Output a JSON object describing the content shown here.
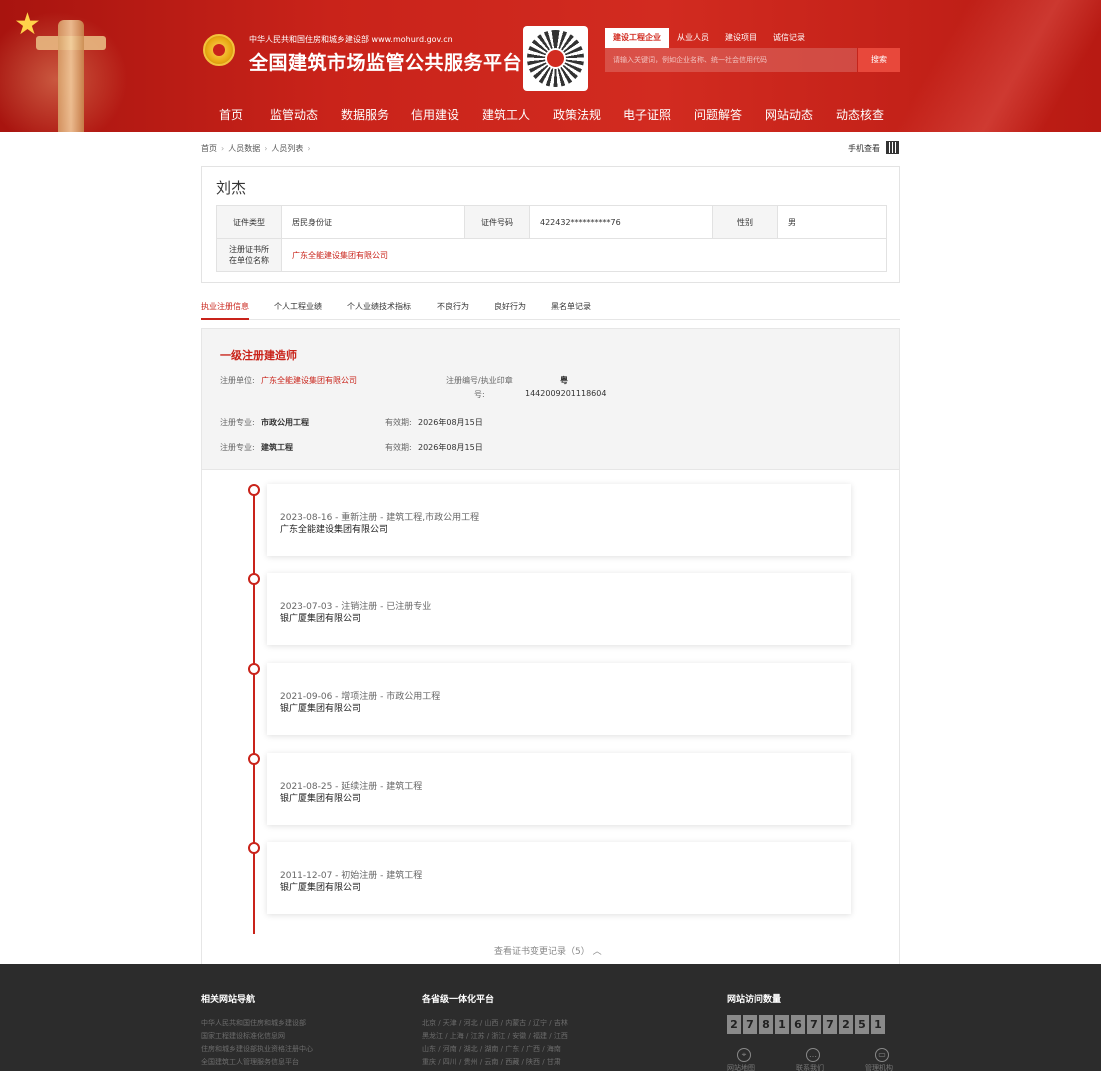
{
  "header": {
    "org_line": "中华人民共和国住房和城乡建设部  www.mohurd.gov.cn",
    "site_title": "全国建筑市场监管公共服务平台",
    "search_tabs": [
      "建设工程企业",
      "从业人员",
      "建设项目",
      "诚信记录"
    ],
    "search_placeholder": "请输入关键词，例如企业名称、统一社会信用代码",
    "search_button": "搜索"
  },
  "nav": [
    "首页",
    "监管动态",
    "数据服务",
    "信用建设",
    "建筑工人",
    "政策法规",
    "电子证照",
    "问题解答",
    "网站动态",
    "动态核查"
  ],
  "breadcrumb": [
    "首页",
    "人员数据",
    "人员列表"
  ],
  "mobile_view": "手机查看",
  "person": {
    "name": "刘杰",
    "id_type_label": "证件类型",
    "id_type": "居民身份证",
    "id_no_label": "证件号码",
    "id_no": "422432**********76",
    "gender_label": "性别",
    "gender": "男",
    "company_label": "注册证书所在单位名称",
    "company": "广东全能建设集团有限公司"
  },
  "tabs": [
    "执业注册信息",
    "个人工程业绩",
    "个人业绩技术指标",
    "不良行为",
    "良好行为",
    "黑名单记录"
  ],
  "registration": {
    "title": "一级注册建造师",
    "unit_label": "注册单位:",
    "unit": "广东全能建设集团有限公司",
    "reg_no_label_1": "注册编号/执业印章",
    "reg_no_label_2": "号:",
    "reg_no_prefix": "粤",
    "reg_no": "144200920111860​4",
    "specialties": [
      {
        "label": "注册专业:",
        "name": "市政公用工程",
        "valid_label": "有效期:",
        "valid": "2026年08月15日"
      },
      {
        "label": "注册专业:",
        "name": "建筑工程",
        "valid_label": "有效期:",
        "valid": "2026年08月15日"
      }
    ]
  },
  "timeline": [
    {
      "title": "2023-08-16 - 重新注册 - 建筑工程,市政公用工程",
      "company": "广东全能建设集团有限公司"
    },
    {
      "title": "2023-07-03 - 注销注册 - 已注册专业",
      "company": "银广厦集团有限公司"
    },
    {
      "title": "2021-09-06 - 增项注册 - 市政公用工程",
      "company": "银广厦集团有限公司"
    },
    {
      "title": "2021-08-25 - 延续注册 - 建筑工程",
      "company": "银广厦集团有限公司"
    },
    {
      "title": "2011-12-07 - 初始注册 - 建筑工程",
      "company": "银广厦集团有限公司"
    }
  ],
  "more_link": "查看证书变更记录（5） ︿",
  "footer": {
    "col1_title": "相关网站导航",
    "col1_links": [
      "中华人民共和国住房和城乡建设部",
      "国家工程建设标准化信息网",
      "住房和城乡建设部执业资格注册中心",
      "全国建筑工人管理服务信息平台"
    ],
    "col2_title": "各省级一体化平台",
    "col2_links": [
      "北京 / 天津 / 河北 / 山西 / 内蒙古 / 辽宁 / 吉林",
      "黑龙江 / 上海 / 江苏 / 浙江 / 安徽 / 福建 / 江西",
      "山东 / 河南 / 湖北 / 湖南 / 广东 / 广西 / 海南",
      "重庆 / 四川 / 贵州 / 云南 / 西藏 / 陕西 / 甘肃"
    ],
    "col3_title": "网站访问数量",
    "counter": [
      "2",
      "7",
      "8",
      "1",
      "6",
      "7",
      "7",
      "2",
      "5",
      "1"
    ],
    "icons": [
      {
        "name": "location-icon",
        "glyph": "⌖",
        "label": "网站地图"
      },
      {
        "name": "chat-icon",
        "glyph": "…",
        "label": "联系我们"
      },
      {
        "name": "monitor-icon",
        "glyph": "▭",
        "label": "管理机构"
      }
    ]
  },
  "colors": {
    "brand_red": "#c9231a",
    "footer_bg": "#2c2c2c"
  }
}
